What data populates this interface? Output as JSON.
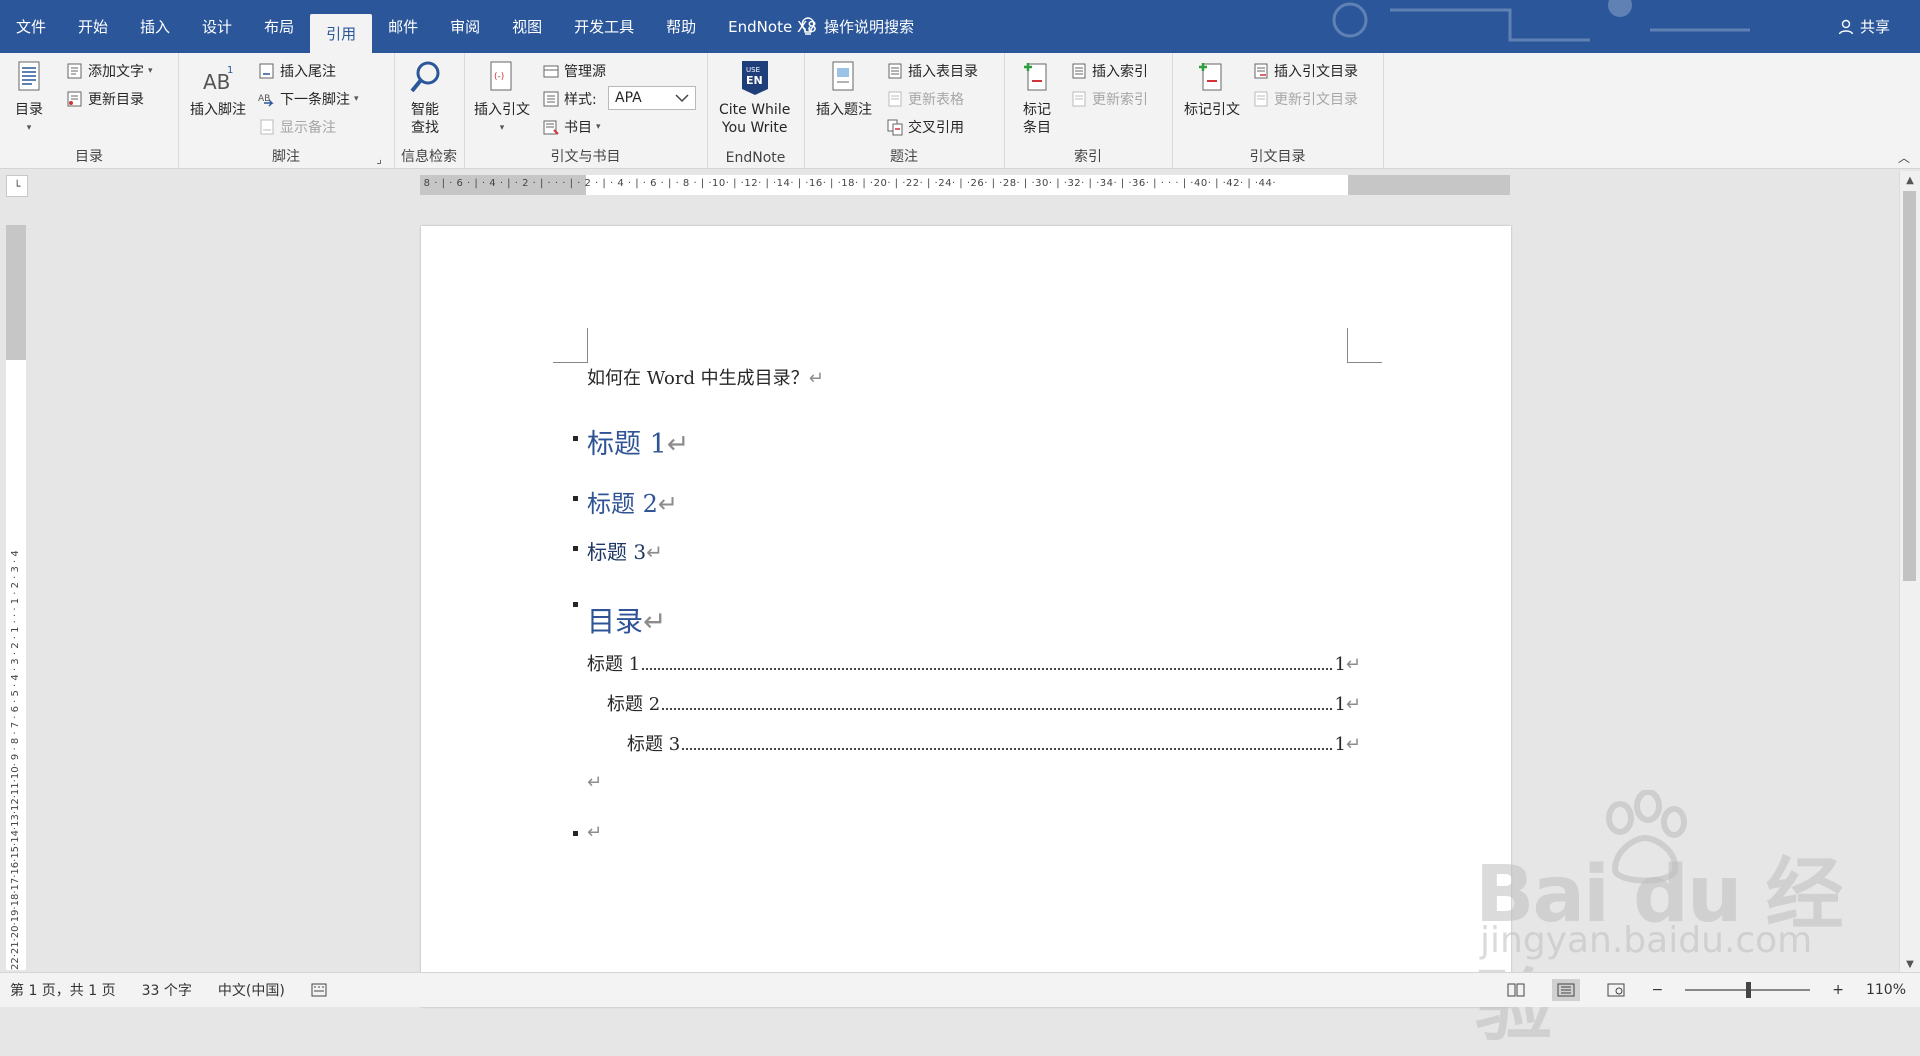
{
  "tabs": [
    "文件",
    "开始",
    "插入",
    "设计",
    "布局",
    "引用",
    "邮件",
    "审阅",
    "视图",
    "开发工具",
    "帮助",
    "EndNote X8"
  ],
  "active_tab": "引用",
  "tell_me": "操作说明搜索",
  "share": "共享",
  "ribbon": {
    "toc": {
      "big": "目录",
      "add_text": "添加文字",
      "update": "更新目录",
      "label": "目录"
    },
    "footnote": {
      "insert": "插入脚注",
      "endnote": "插入尾注",
      "next": "下一条脚注",
      "show": "显示备注",
      "label": "脚注"
    },
    "research": {
      "smart": "智能",
      "lookup": "查找",
      "label": "信息检索"
    },
    "citations": {
      "insert": "插入引文",
      "manage": "管理源",
      "style_label": "样式:",
      "style_value": "APA",
      "biblio": "书目",
      "label": "引文与书目"
    },
    "endnote": {
      "line1": "Cite While",
      "line2": "You Write",
      "label": "EndNote",
      "logo1": "USE",
      "logo2": "EN"
    },
    "captions": {
      "insert": "插入题注",
      "table_of_figures": "插入表目录",
      "update_table": "更新表格",
      "cross_ref": "交叉引用",
      "label": "题注"
    },
    "index": {
      "mark1": "标记",
      "mark2": "条目",
      "insert": "插入索引",
      "update": "更新索引",
      "label": "索引"
    },
    "authorities": {
      "mark": "标记引文",
      "insert": "插入引文目录",
      "update": "更新引文目录",
      "label": "引文目录"
    }
  },
  "document": {
    "intro": "如何在 Word 中生成目录？",
    "h1": "标题 1",
    "h2": "标题 2",
    "h3": "标题 3",
    "toc_title": "目录",
    "toc": [
      {
        "text": "标题 1",
        "page": "1"
      },
      {
        "text": "标题 2",
        "page": "1"
      },
      {
        "text": "标题 3",
        "page": "1"
      }
    ],
    "para_mark": "↵"
  },
  "status": {
    "page": "第 1 页，共 1 页",
    "words": "33 个字",
    "lang": "中文(中国)",
    "zoom": "110%",
    "zoom_level_percent": 110
  },
  "watermark": {
    "brand": "Bai du 经验",
    "url": "jingyan.baidu.com"
  },
  "colors": {
    "title_bar": "#2b579a",
    "heading": "#2f5496",
    "ribbon_bg": "#f3f3f3"
  }
}
